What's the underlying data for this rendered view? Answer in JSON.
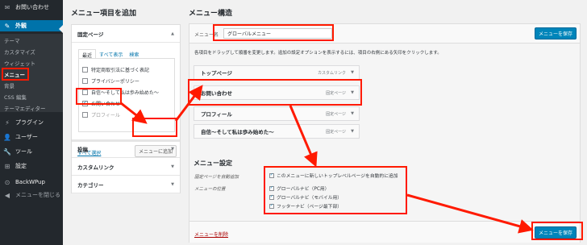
{
  "sidebar": {
    "contact_label": "お問い合わせ",
    "appearance_label": "外観",
    "submenu": [
      "テーマ",
      "カスタマイズ",
      "ウィジェット",
      "メニュー",
      "背景",
      "CSS 編集",
      "テーマエディター"
    ],
    "items": [
      "プラグイン",
      "ユーザー",
      "ツール",
      "設定",
      "BackWPup"
    ],
    "collapse_label": "メニューを閉じる"
  },
  "left": {
    "heading": "メニュー項目を追加",
    "fixed_pages_label": "固定ページ",
    "tabs": [
      "最近",
      "すべて表示",
      "検索"
    ],
    "pages": [
      "特定商取引法に基づく表記",
      "プライバシーポリシー",
      "自信〜そして私は歩み始めた〜",
      "お問い合わせ",
      "プロフィール"
    ],
    "checked_page": "お問い合わせ",
    "select_all": "すべて選択",
    "add_button": "メニューに追加",
    "sections": [
      "投稿",
      "カスタムリンク",
      "カテゴリー"
    ]
  },
  "right": {
    "heading": "メニュー構造",
    "name_label": "メニュー名",
    "menu_name": "グローバルメニュー",
    "save_button": "メニューを保存",
    "instructions": "各項目をドラッグして順番を変更します。追加の設定オプションを表示するには、項目の右側にある矢印をクリックします。",
    "items": [
      {
        "label": "トップページ",
        "type": "カスタムリンク"
      },
      {
        "label": "お問い合わせ",
        "type": "固定ページ"
      },
      {
        "label": "プロフィール",
        "type": "固定ページ"
      },
      {
        "label": "自信〜そして私は歩み始めた〜",
        "type": "固定ページ"
      }
    ],
    "settings_heading": "メニュー設定",
    "auto_add_label": "固定ページを自動追加",
    "auto_add_option": "このメニューに新しいトップレベルページを自動的に追加",
    "position_label": "メニューの位置",
    "positions": [
      "グローバルナビ（PC用）",
      "グローバルナビ（モバイル用）",
      "フッターナビ（ページ最下部）"
    ],
    "delete_link": "メニューを削除"
  },
  "accent_color": "#0085ba",
  "annotation_color": "#ff1a00"
}
